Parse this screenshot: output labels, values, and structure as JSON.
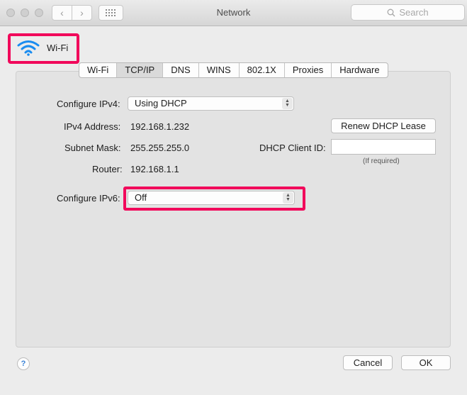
{
  "window": {
    "title": "Network"
  },
  "search": {
    "placeholder": "Search"
  },
  "header": {
    "service": "Wi-Fi"
  },
  "tabs": [
    "Wi-Fi",
    "TCP/IP",
    "DNS",
    "WINS",
    "802.1X",
    "Proxies",
    "Hardware"
  ],
  "active_tab": "TCP/IP",
  "ipv4": {
    "configure_label": "Configure IPv4:",
    "configure_value": "Using DHCP",
    "address_label": "IPv4 Address:",
    "address_value": "192.168.1.232",
    "subnet_label": "Subnet Mask:",
    "subnet_value": "255.255.255.0",
    "router_label": "Router:",
    "router_value": "192.168.1.1"
  },
  "dhcp": {
    "renew_label": "Renew DHCP Lease",
    "client_id_label": "DHCP Client ID:",
    "client_id_value": "",
    "client_id_hint": "(If required)"
  },
  "ipv6": {
    "configure_label": "Configure IPv6:",
    "configure_value": "Off"
  },
  "footer": {
    "help_label": "?",
    "cancel_label": "Cancel",
    "ok_label": "OK"
  },
  "colors": {
    "highlight": "#f1095b",
    "wifi_blue": "#1a8cf0"
  }
}
